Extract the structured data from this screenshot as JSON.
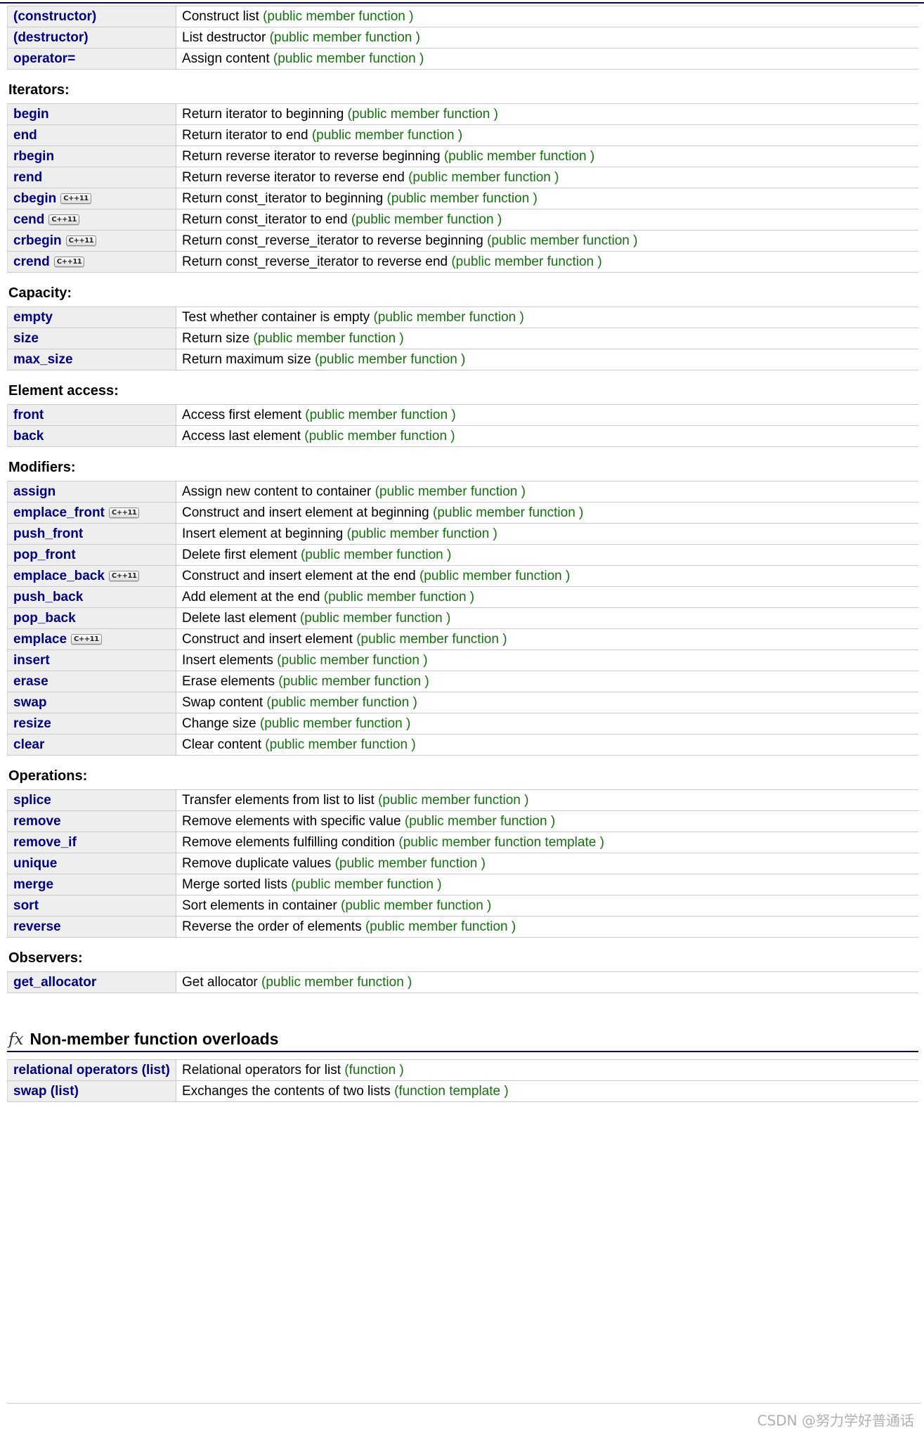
{
  "page": {
    "watermark": "CSDN @努力学好普通话",
    "badge_label": "C++11",
    "fx_icon": "fx",
    "accent_color": "#000066",
    "name_color": "#000080",
    "green_color": "#15700f",
    "row_bg": "#eeeeee"
  },
  "sections": [
    {
      "heading": null,
      "rows": [
        {
          "name": "(constructor)",
          "badge": false,
          "desc": "Construct list ",
          "kind": "(public member function )"
        },
        {
          "name": "(destructor)",
          "badge": false,
          "desc": "List destructor ",
          "kind": "(public member function )"
        },
        {
          "name": "operator=",
          "badge": false,
          "desc": "Assign content ",
          "kind": "(public member function )"
        }
      ]
    },
    {
      "heading": "Iterators:",
      "rows": [
        {
          "name": "begin",
          "badge": false,
          "desc": "Return iterator to beginning ",
          "kind": "(public member function )"
        },
        {
          "name": "end",
          "badge": false,
          "desc": "Return iterator to end ",
          "kind": "(public member function )"
        },
        {
          "name": "rbegin",
          "badge": false,
          "desc": "Return reverse iterator to reverse beginning ",
          "kind": "(public member function )"
        },
        {
          "name": "rend",
          "badge": false,
          "desc": "Return reverse iterator to reverse end ",
          "kind": "(public member function )"
        },
        {
          "name": "cbegin",
          "badge": true,
          "desc": "Return const_iterator to beginning ",
          "kind": "(public member function )"
        },
        {
          "name": "cend",
          "badge": true,
          "desc": "Return const_iterator to end ",
          "kind": "(public member function )"
        },
        {
          "name": "crbegin",
          "badge": true,
          "desc": "Return const_reverse_iterator to reverse beginning ",
          "kind": "(public member function )"
        },
        {
          "name": "crend",
          "badge": true,
          "desc": "Return const_reverse_iterator to reverse end ",
          "kind": "(public member function )"
        }
      ]
    },
    {
      "heading": "Capacity:",
      "rows": [
        {
          "name": "empty",
          "badge": false,
          "desc": "Test whether container is empty ",
          "kind": "(public member function )"
        },
        {
          "name": "size",
          "badge": false,
          "desc": "Return size ",
          "kind": "(public member function )"
        },
        {
          "name": "max_size",
          "badge": false,
          "desc": "Return maximum size ",
          "kind": "(public member function )"
        }
      ]
    },
    {
      "heading": "Element access:",
      "rows": [
        {
          "name": "front",
          "badge": false,
          "desc": "Access first element ",
          "kind": "(public member function )"
        },
        {
          "name": "back",
          "badge": false,
          "desc": "Access last element ",
          "kind": "(public member function )"
        }
      ]
    },
    {
      "heading": "Modifiers:",
      "rows": [
        {
          "name": "assign",
          "badge": false,
          "desc": "Assign new content to container ",
          "kind": "(public member function )"
        },
        {
          "name": "emplace_front",
          "badge": true,
          "desc": "Construct and insert element at beginning ",
          "kind": "(public member function )"
        },
        {
          "name": "push_front",
          "badge": false,
          "desc": "Insert element at beginning ",
          "kind": "(public member function )"
        },
        {
          "name": "pop_front",
          "badge": false,
          "desc": "Delete first element ",
          "kind": "(public member function )"
        },
        {
          "name": "emplace_back",
          "badge": true,
          "desc": "Construct and insert element at the end ",
          "kind": "(public member function )"
        },
        {
          "name": "push_back",
          "badge": false,
          "desc": "Add element at the end ",
          "kind": "(public member function )"
        },
        {
          "name": "pop_back",
          "badge": false,
          "desc": "Delete last element ",
          "kind": "(public member function )"
        },
        {
          "name": "emplace",
          "badge": true,
          "desc": "Construct and insert element ",
          "kind": "(public member function )"
        },
        {
          "name": "insert",
          "badge": false,
          "desc": "Insert elements ",
          "kind": "(public member function )"
        },
        {
          "name": "erase",
          "badge": false,
          "desc": "Erase elements ",
          "kind": "(public member function )"
        },
        {
          "name": "swap",
          "badge": false,
          "desc": "Swap content ",
          "kind": "(public member function )"
        },
        {
          "name": "resize",
          "badge": false,
          "desc": "Change size ",
          "kind": "(public member function )"
        },
        {
          "name": "clear",
          "badge": false,
          "desc": "Clear content ",
          "kind": "(public member function )"
        }
      ]
    },
    {
      "heading": "Operations:",
      "rows": [
        {
          "name": "splice",
          "badge": false,
          "desc": "Transfer elements from list to list ",
          "kind": "(public member function )"
        },
        {
          "name": "remove",
          "badge": false,
          "desc": "Remove elements with specific value ",
          "kind": "(public member function )"
        },
        {
          "name": "remove_if",
          "badge": false,
          "desc": "Remove elements fulfilling condition ",
          "kind": "(public member function template )"
        },
        {
          "name": "unique",
          "badge": false,
          "desc": "Remove duplicate values ",
          "kind": "(public member function )"
        },
        {
          "name": "merge",
          "badge": false,
          "desc": "Merge sorted lists ",
          "kind": "(public member function )"
        },
        {
          "name": "sort",
          "badge": false,
          "desc": "Sort elements in container ",
          "kind": "(public member function )"
        },
        {
          "name": "reverse",
          "badge": false,
          "desc": "Reverse the order of elements ",
          "kind": "(public member function )"
        }
      ]
    },
    {
      "heading": "Observers:",
      "rows": [
        {
          "name": "get_allocator",
          "badge": false,
          "desc": "Get allocator ",
          "kind": "(public member function )"
        }
      ]
    }
  ],
  "nonmember": {
    "title": "Non-member function overloads",
    "rows": [
      {
        "name": "relational operators (list)",
        "badge": false,
        "desc": "Relational operators for list ",
        "kind": "(function )",
        "narrow": true
      },
      {
        "name": "swap (list)",
        "badge": false,
        "desc": "Exchanges the contents of two lists ",
        "kind": "(function template )",
        "narrow": false
      }
    ]
  }
}
